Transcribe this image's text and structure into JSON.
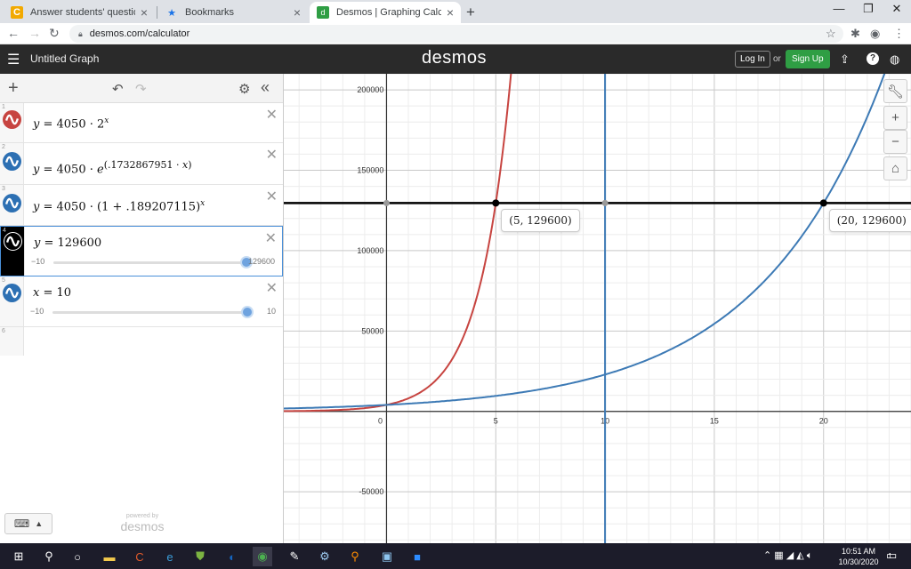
{
  "browser": {
    "tabs": [
      {
        "title": "Answer students' questions and e",
        "favicon": "chegg-icon"
      },
      {
        "title": "Bookmarks",
        "favicon": "star-icon"
      },
      {
        "title": "Desmos | Graphing Calculator",
        "favicon": "desmos-icon",
        "active": true
      }
    ],
    "url": "desmos.com/calculator"
  },
  "header": {
    "graph_title": "Untitled Graph",
    "logo": "desmos",
    "login_label": "Log In",
    "or_label": "or",
    "signup_label": "Sign Up",
    "signup_color": "#2f9e44"
  },
  "expressions": [
    {
      "num": "1",
      "color": "#c74440",
      "latex": "y = 4050 · 2^x"
    },
    {
      "num": "2",
      "color": "#2d70b3",
      "latex": "y = 4050 · e^(.1732867951 · x)"
    },
    {
      "num": "3",
      "color": "#2d70b3",
      "latex": "y = 4050 · (1 + .189207115)^x"
    },
    {
      "num": "4",
      "color": "#000000",
      "latex": "y = 129600",
      "slider": {
        "min": "−10",
        "max": "129600",
        "fraction": 1.0
      }
    },
    {
      "num": "5",
      "color": "#2d70b3",
      "latex": "x = 10",
      "slider": {
        "min": "−10",
        "max": "10",
        "fraction": 1.0
      }
    },
    {
      "num": "6"
    }
  ],
  "powered_by": {
    "line1": "powered by",
    "line2": "desmos"
  },
  "point_labels": [
    "(5, 129600)",
    "(20, 129600)"
  ],
  "chart_data": {
    "type": "line",
    "x_ticks": [
      "0",
      "5",
      "10",
      "15",
      "20"
    ],
    "y_ticks": [
      "200000",
      "150000",
      "100000",
      "50000",
      "-50000"
    ],
    "xlim": [
      -4.7,
      24
    ],
    "ylim": [
      -82000,
      210000
    ],
    "grid": true,
    "series": [
      {
        "expr": "4050*2^x",
        "color": "#c74440"
      },
      {
        "expr": "4050*1.189207115^x",
        "color": "#3d7ab5"
      }
    ],
    "hlines": [
      {
        "y": 129600,
        "color": "#000000"
      }
    ],
    "vlines": [
      {
        "x": 10,
        "color": "#3d7ab5"
      }
    ],
    "points": [
      {
        "x": 5,
        "y": 129600,
        "label": "(5, 129600)"
      },
      {
        "x": 20,
        "y": 129600,
        "label": "(20, 129600)"
      },
      {
        "x": 0,
        "y": 129600
      },
      {
        "x": 10,
        "y": 129600
      }
    ]
  },
  "taskbar": {
    "time": "10:51 AM",
    "date": "10/30/2020",
    "notification_count": "1"
  }
}
